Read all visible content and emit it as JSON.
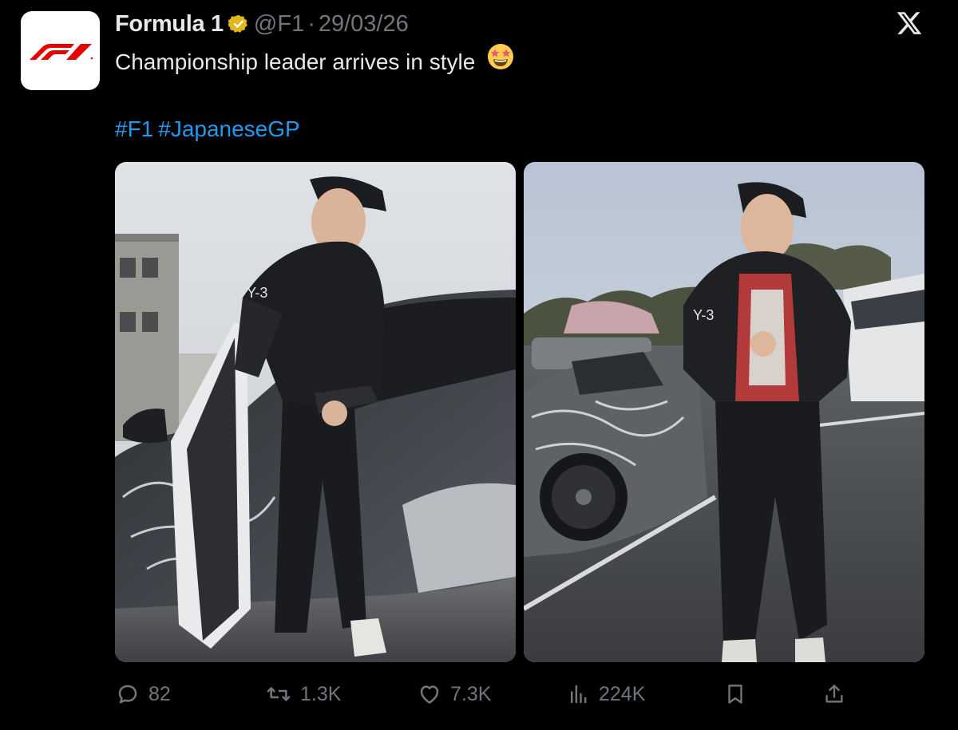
{
  "author": {
    "display_name": "Formula 1",
    "handle": "@F1",
    "separator": "·",
    "date": "29/03/26",
    "verified": true,
    "avatar_icon": "f1-logo-icon"
  },
  "tweet": {
    "text": "Championship leader arrives in style",
    "emoji": "star-struck-emoji",
    "hashtags": [
      "#F1",
      "#JapaneseGP"
    ]
  },
  "media": {
    "count": 2,
    "items": [
      {
        "kind": "photo"
      },
      {
        "kind": "photo"
      }
    ]
  },
  "actions": {
    "replies": "82",
    "reposts": "1.3K",
    "likes": "7.3K",
    "views": "224K"
  },
  "colors": {
    "background": "#000000",
    "text": "#e7e9ea",
    "secondary": "#71767b",
    "link": "#1d9bf0",
    "verified_gold": "#e2b719",
    "f1_red": "#e10600"
  },
  "icons": {
    "close": "x-logo-icon",
    "reply": "reply-bubble-icon",
    "repost": "repost-icon",
    "like": "heart-icon",
    "views": "views-bars-icon",
    "bookmark": "bookmark-icon",
    "share": "share-icon"
  }
}
